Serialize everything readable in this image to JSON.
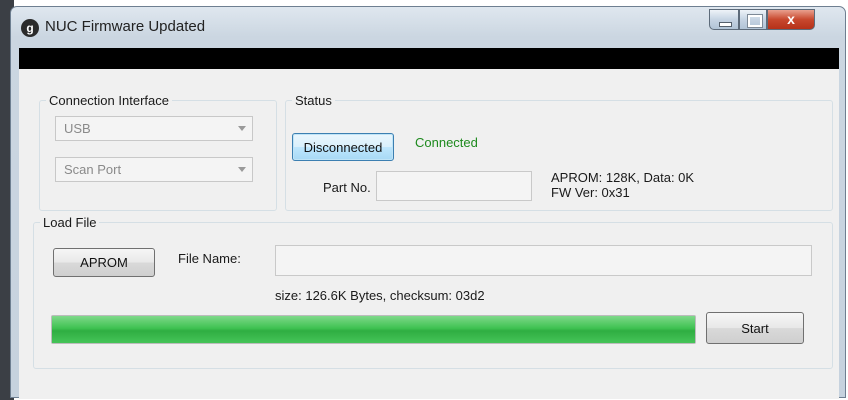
{
  "window": {
    "title": "NUC Firmware Updated",
    "close_glyph": "x",
    "app_icon": "g"
  },
  "connection": {
    "legend": "Connection Interface",
    "interface_value": "USB",
    "port_value": "Scan Port"
  },
  "status": {
    "legend": "Status",
    "connect_button": "Disconnected",
    "state_text": "Connected",
    "state_color": "#1e8a1e",
    "part_label": "Part No.",
    "part_value": "",
    "aprom_info": "APROM: 128K, Data: 0K",
    "fw_version": "FW Ver: 0x31"
  },
  "load": {
    "legend": "Load File",
    "aprom_button": "APROM",
    "file_label": "File Name:",
    "file_value": "",
    "info": "size: 126.6K Bytes, checksum: 03d2",
    "progress": 1.0,
    "start_button": "Start"
  }
}
